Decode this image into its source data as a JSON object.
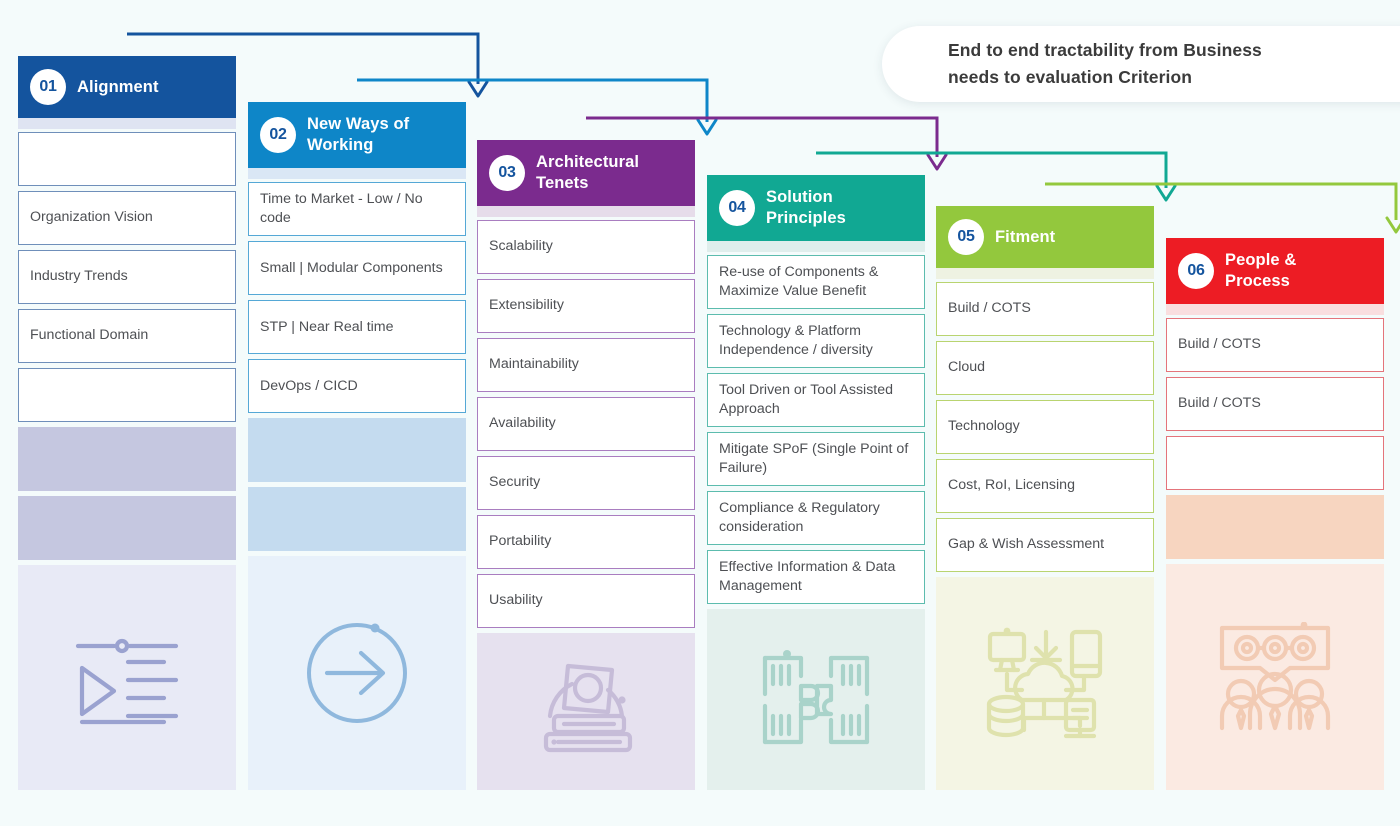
{
  "callout": {
    "line1": "End to end tractability from Business",
    "line2": "needs to evaluation Criterion"
  },
  "columns": [
    {
      "number": "01",
      "title": "Alignment",
      "title_lines": [
        "Alignment"
      ],
      "header_color": "#14549e",
      "strip_color": "#dfe4f2",
      "card_border": "#6f8fba",
      "filler_color": "#c5c7e0",
      "pad_color": "#e8eaf6",
      "icon": "list-play-icon",
      "icon_color": "#9aa2d0",
      "cards": [
        "",
        "Organization Vision",
        "Industry Trends",
        "Functional Domain",
        ""
      ]
    },
    {
      "number": "02",
      "title": "New Ways of Working",
      "title_lines": [
        "New Ways of",
        "Working"
      ],
      "header_color": "#0e86c8",
      "strip_color": "#dae7f5",
      "card_border": "#55a8d6",
      "filler_color": "#c4dbef",
      "pad_color": "#e8f1fa",
      "icon": "circle-arrow-right-icon",
      "icon_color": "#8fb8dd",
      "cards": [
        "Time to Market - Low / No code",
        "Small | Modular Components",
        "STP | Near Real time",
        "DevOps / CICD"
      ]
    },
    {
      "number": "03",
      "title": "Architectural Tenets",
      "title_lines": [
        "Architectural",
        "Tenets"
      ],
      "header_color": "#7b2b8e",
      "strip_color": "#e6dcea",
      "card_border": "#a97dc0",
      "filler_color": "#ddd5e9",
      "pad_color": "#e6e1ef",
      "icon": "architecture-books-icon",
      "icon_color": "#c6bcd8",
      "cards": [
        "Scalability",
        "Extensibility",
        "Maintainability",
        "Availability",
        "Security",
        "Portability",
        "Usability"
      ]
    },
    {
      "number": "04",
      "title": "Solution Principles",
      "title_lines": [
        "Solution",
        "Principles"
      ],
      "header_color": "#11a893",
      "strip_color": "#dfeeec",
      "card_border": "#5cbcae",
      "filler_color": "#d8ebe7",
      "pad_color": "#e4f0ed",
      "icon": "puzzle-hands-icon",
      "icon_color": "#a9d3ca",
      "cards": [
        "Re-use of Components & Maximize Value Benefit",
        "Technology & Platform Independence / diversity",
        "Tool Driven or Tool Assisted Approach",
        "Mitigate SPoF (Single Point of Failure)",
        "Compliance & Regulatory consideration",
        "Effective Information & Data Management"
      ]
    },
    {
      "number": "05",
      "title": "Fitment",
      "title_lines": [
        "Fitment"
      ],
      "header_color": "#93c83d",
      "strip_color": "#eef2e2",
      "card_border": "#b9d470",
      "filler_color": "#e9eed3",
      "pad_color": "#f4f5e4",
      "icon": "cloud-devices-icon",
      "icon_color": "#dfe2ad",
      "cards": [
        "Build / COTS",
        "Cloud",
        "Technology",
        "Cost, RoI, Licensing",
        "Gap & Wish Assessment"
      ]
    },
    {
      "number": "06",
      "title": "People & Process",
      "title_lines": [
        "People &",
        "Process"
      ],
      "header_color": "#ed1c24",
      "strip_color": "#f9dedf",
      "card_border": "#e4747b",
      "filler_color": "#f7d5c0",
      "pad_color": "#fbeae2",
      "icon": "team-people-icon",
      "icon_color": "#f2cbb4",
      "cards": [
        "Build / COTS",
        "Build / COTS",
        ""
      ]
    }
  ],
  "connectors": [
    {
      "color": "#14549e"
    },
    {
      "color": "#0e86c8"
    },
    {
      "color": "#7b2b8e"
    },
    {
      "color": "#11a893"
    },
    {
      "color": "#93c83d"
    }
  ]
}
